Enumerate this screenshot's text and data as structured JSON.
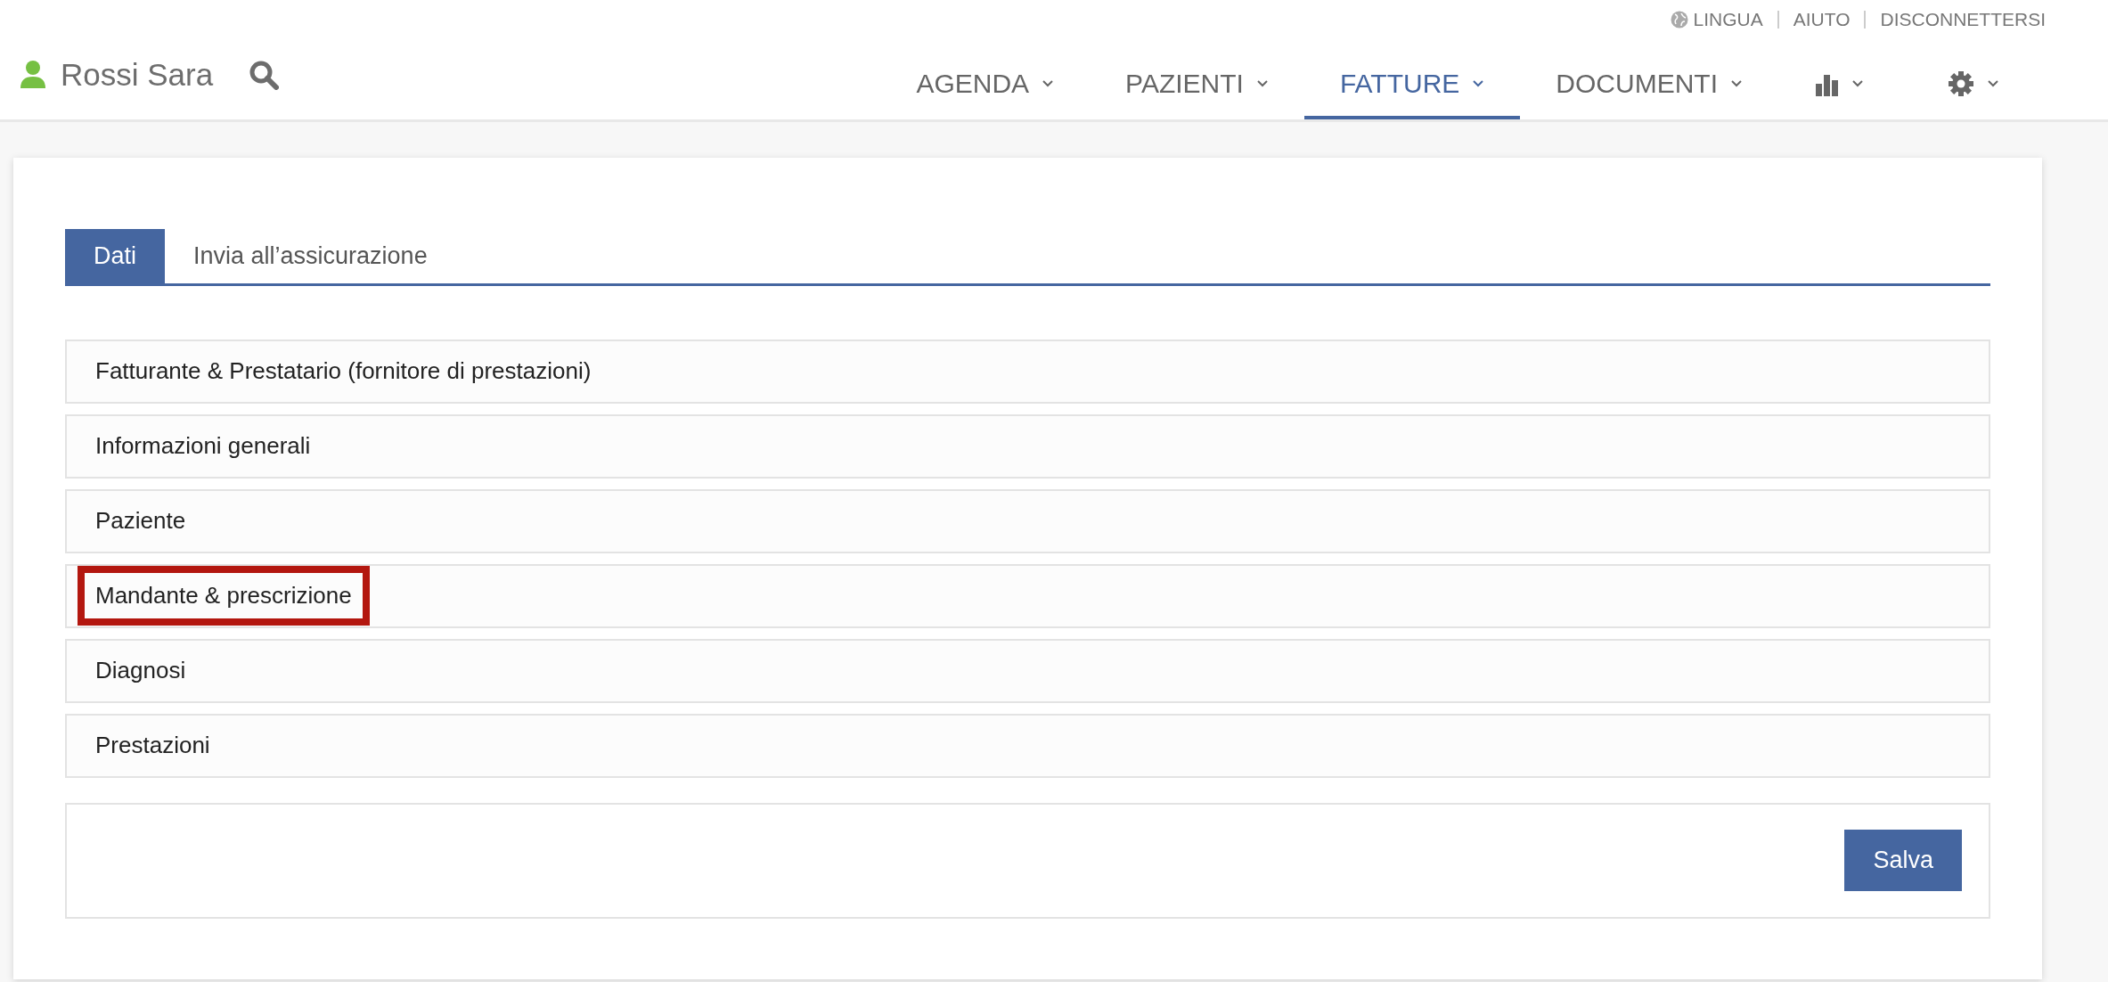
{
  "top_links": [
    {
      "kind": "globe",
      "label": "LINGUA"
    },
    {
      "kind": "plain",
      "label": "AIUTO"
    },
    {
      "kind": "plain",
      "label": "DISCONNETTERSI"
    }
  ],
  "user": {
    "name": "Rossi Sara"
  },
  "nav": [
    {
      "kind": "text",
      "label": "AGENDA",
      "selected": false
    },
    {
      "kind": "text",
      "label": "PAZIENTI",
      "selected": false
    },
    {
      "kind": "text",
      "label": "FATTURE",
      "selected": true
    },
    {
      "kind": "text",
      "label": "DOCUMENTI",
      "selected": false
    },
    {
      "kind": "chart",
      "selected": false
    },
    {
      "kind": "gear",
      "selected": false
    }
  ],
  "tabs": [
    {
      "label": "Dati",
      "selected": true
    },
    {
      "label": "Invia all’assicurazione",
      "selected": false
    }
  ],
  "sections": [
    {
      "label": "Fatturante & Prestatario (fornitore di prestazioni)",
      "highlighted": false
    },
    {
      "label": "Informazioni generali",
      "highlighted": false
    },
    {
      "label": "Paziente",
      "highlighted": false
    },
    {
      "label": "Mandante & prescrizione",
      "highlighted": true
    },
    {
      "label": "Diagnosi",
      "highlighted": false
    },
    {
      "label": "Prestazioni",
      "highlighted": false
    }
  ],
  "save_button": "Salva"
}
